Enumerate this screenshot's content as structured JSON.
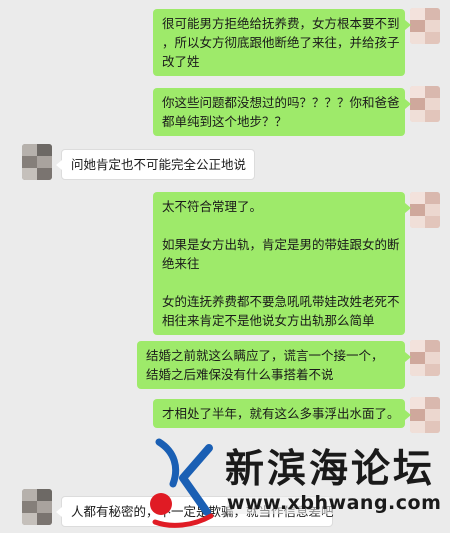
{
  "messages": [
    {
      "side": "sent",
      "lines": [
        "很可能男方拒绝给抚养费，女方根本要不到",
        "，所以女方彻底跟他断绝了来往，并给孩子",
        "改了姓"
      ]
    },
    {
      "side": "sent",
      "lines": [
        "你这些问题都没想过的吗？？？？你和爸爸",
        "都单纯到这个地步？？"
      ]
    },
    {
      "side": "recv",
      "lines": [
        "问她肯定也不可能完全公正地说"
      ]
    },
    {
      "side": "sent",
      "paragraphs": [
        [
          "太不符合常理了。"
        ],
        [
          "如果是女方出轨，肯定是男的带娃跟女的断",
          "绝来往"
        ],
        [
          "女的连抚养费都不要急吼吼带娃改姓老死不",
          "相往来肯定不是他说女方出轨那么简单"
        ]
      ]
    },
    {
      "side": "sent",
      "lines": [
        "结婚之前就这么瞒应了，谎言一个接一个，",
        "结婚之后难保没有什么事搭着不说"
      ]
    },
    {
      "side": "sent",
      "lines": [
        "才相处了半年，就有这么多事浮出水面了。"
      ]
    },
    {
      "side": "recv",
      "lines": [
        "人都有秘密的，不一定是欺骗，就当作信息差吧"
      ]
    }
  ],
  "watermark": {
    "title": "新滨海论坛",
    "url": "www.xbhwang.com",
    "colors": {
      "blue": "#1a5fb4",
      "red": "#e01b24"
    }
  },
  "colors": {
    "sent_bubble": "#9eea6a",
    "recv_bubble": "#ffffff",
    "background": "#ebebeb"
  }
}
